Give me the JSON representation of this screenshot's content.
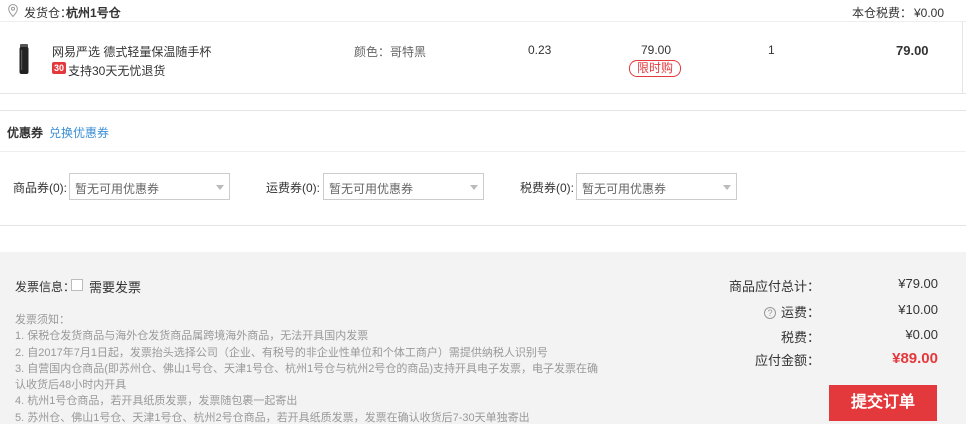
{
  "warehouse": {
    "label": "发货仓：",
    "name": "杭州1号仓",
    "tax_label": "本仓税费：",
    "tax_value": "¥0.00"
  },
  "product": {
    "name": "网易严选 德式轻量保温随手杯",
    "badge": "30",
    "return_policy": "支持30天无忧退货",
    "spec": "颜色：哥特黑",
    "weight": "0.23",
    "price": "79.00",
    "promo_tag": "限时购",
    "quantity": "1",
    "subtotal": "79.00"
  },
  "coupons": {
    "title": "优惠券",
    "switch_link": "兑换优惠券",
    "items": [
      {
        "label": "商品券(0):",
        "placeholder": "暂无可用优惠券"
      },
      {
        "label": "运费券(0):",
        "placeholder": "暂无可用优惠券"
      },
      {
        "label": "税费券(0):",
        "placeholder": "暂无可用优惠券"
      }
    ]
  },
  "invoice": {
    "label": "发票信息：",
    "option": "需要发票",
    "notes": [
      "发票须知：",
      "1. 保税仓发货商品与海外仓发货商品属跨境海外商品，无法开具国内发票",
      "2. 自2017年7月1日起，发票抬头选择公司（企业、有税号的非企业性单位和个体工商户）需提供纳税人识别号",
      "3. 自营国内仓商品(即苏州仓、佛山1号仓、天津1号仓、杭州1号仓与杭州2号仓的商品)支持开具电子发票，电子发票在确",
      "认收货后48小时内开具",
      "4. 杭州1号仓商品，若开具纸质发票，发票随包裹一起寄出",
      "5. 苏州仓、佛山1号仓、天津1号仓、杭州2号仓商品，若开具纸质发票，发票在确认收货后7-30天单独寄出"
    ]
  },
  "summary": {
    "goods_label": "商品应付总计：",
    "goods_value": "¥79.00",
    "shipping_label": "运费：",
    "shipping_value": "¥10.00",
    "tax_label": "税费：",
    "tax_value": "¥0.00",
    "total_label": "应付金额：",
    "total_value": "¥89.00",
    "submit_label": "提交订单"
  },
  "colors": {
    "accent": "#e4393c",
    "link": "#3b8fd6",
    "footer_bg": "#f3f3f3"
  }
}
